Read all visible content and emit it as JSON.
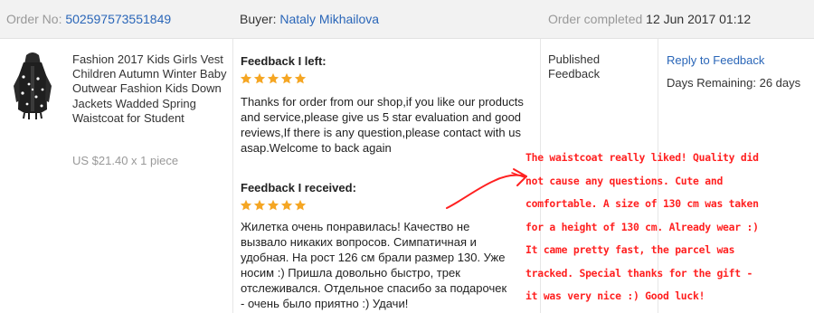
{
  "header": {
    "order_label": "Order No:",
    "order_number": "502597573551849",
    "buyer_label": "Buyer:",
    "buyer_name": "Nataly Mikhailova",
    "completed_label": "Order completed",
    "completed_date": "12 Jun 2017 01:12"
  },
  "product": {
    "image_icon": "kids-vest-product-image",
    "title": "Fashion 2017 Kids Girls Vest Children Autumn Winter Baby Outwear Fashion Kids Down Jackets Wadded Spring Waistcoat for Student",
    "price": "US $21.40 x 1 piece"
  },
  "feedback_left": {
    "heading": "Feedback I left:",
    "stars": 5,
    "text": "Thanks for order from our shop,if you like our products and service,please give us 5 star evaluation and good reviews,If there is any question,please contact with us asap.Welcome to back again"
  },
  "feedback_received": {
    "heading": "Feedback I received:",
    "stars": 5,
    "text_lines": [
      "Жилетка очень понравилась! Качество не",
      "вызвало никаких вопросов. Симпатичная и",
      "удобная. На рост 126 см брали размер 130. Уже",
      "носим :) Пришла довольно быстро, трек",
      "отслеживался. Отдельное спасибо за подарочек",
      "- очень было приятно :) Удачи!"
    ]
  },
  "status": {
    "text": "Published Feedback"
  },
  "actions": {
    "reply_label": "Reply to Feedback",
    "days_remaining": "Days Remaining: 26 days"
  },
  "translation": {
    "lines": [
      "The waistcoat really liked! Quality did",
      "not cause any questions. Cute and",
      "comfortable. A size of 130 cm was taken",
      "for a height of 130 cm. Already wear :)",
      "It came pretty fast, the parcel was",
      "tracked. Special thanks for the gift -",
      "it was very nice :) Good luck!"
    ]
  },
  "colors": {
    "link": "#2a66b8",
    "star": "#f5a623",
    "annotation": "#ff2020",
    "header_bg": "#f2f2f2"
  }
}
